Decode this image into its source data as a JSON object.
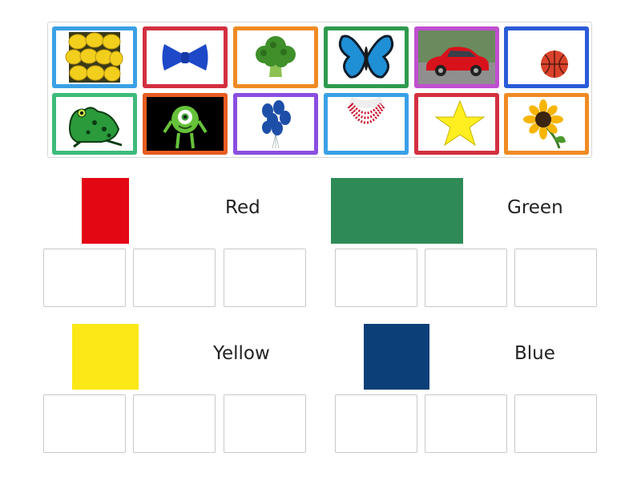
{
  "categories": [
    {
      "label": "Red",
      "color": "#e30613"
    },
    {
      "label": "Green",
      "color": "#2e8b57"
    },
    {
      "label": "Yellow",
      "color": "#fbe816"
    },
    {
      "label": "Blue",
      "color": "#0c3f78"
    }
  ],
  "cards": [
    {
      "item": "lemons-icon",
      "frame_color": "#3aa0e6"
    },
    {
      "item": "bow-tie-icon",
      "frame_color": "#d33040"
    },
    {
      "item": "broccoli-icon",
      "frame_color": "#f08a24"
    },
    {
      "item": "butterfly-icon",
      "frame_color": "#2e9a4e"
    },
    {
      "item": "red-car-icon",
      "frame_color": "#c04fd0"
    },
    {
      "item": "basketball-icon",
      "frame_color": "#2a5bd7"
    },
    {
      "item": "frog-icon",
      "frame_color": "#3dbb7a"
    },
    {
      "item": "green-monster-icon",
      "frame_color": "#e85d22"
    },
    {
      "item": "blue-balloons-icon",
      "frame_color": "#8a4fe0"
    },
    {
      "item": "red-necklace-icon",
      "frame_color": "#3aa0e6"
    },
    {
      "item": "yellow-star-icon",
      "frame_color": "#d33040"
    },
    {
      "item": "sunflower-icon",
      "frame_color": "#f08a24"
    }
  ]
}
